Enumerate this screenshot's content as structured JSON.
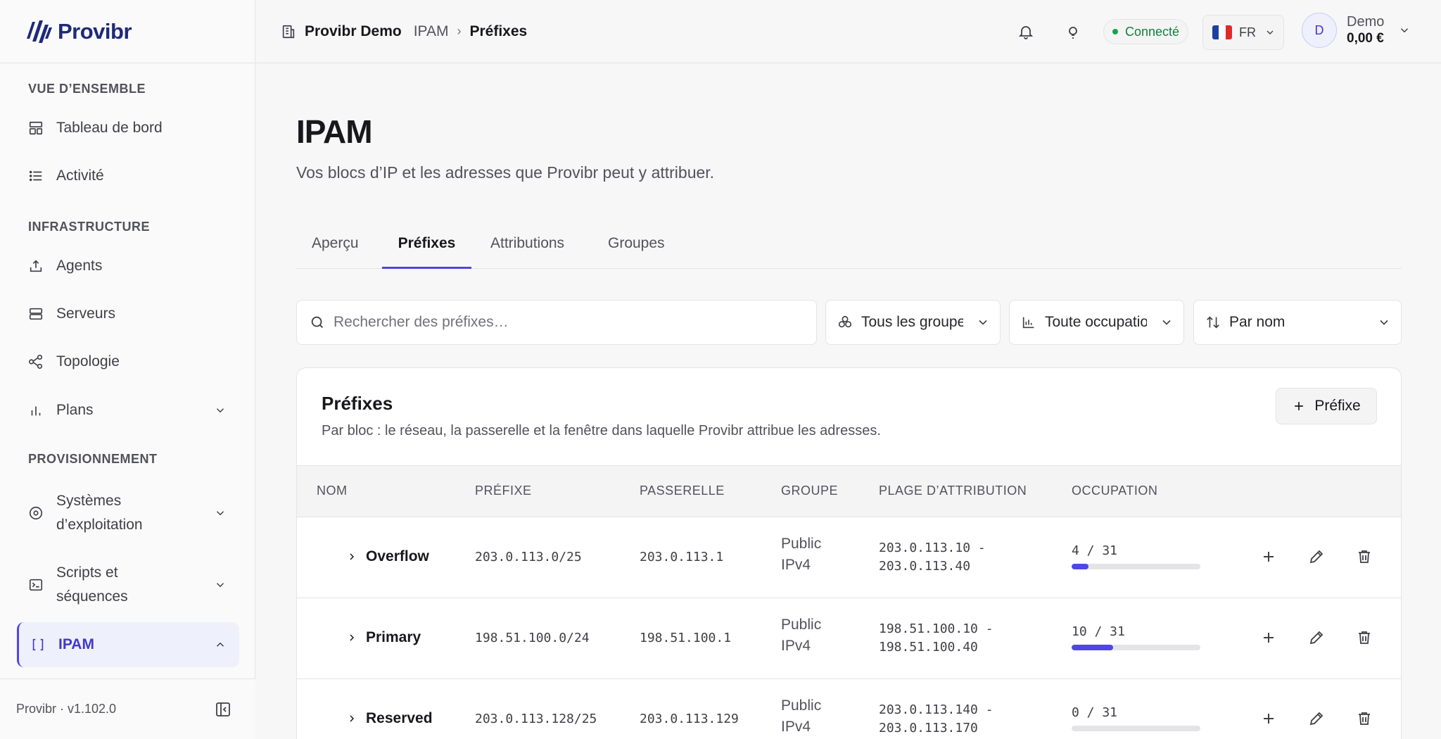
{
  "brand": {
    "name": "Provibr",
    "color": "#1e2a78",
    "accent": "#4f46e5"
  },
  "sidebar": {
    "sections": [
      {
        "title": "VUE D’ENSEMBLE"
      },
      {
        "title": "INFRASTRUCTURE"
      },
      {
        "title": "PROVISIONNEMENT"
      }
    ],
    "items": [
      {
        "label": "Tableau de bord",
        "icon": "dashboard-icon"
      },
      {
        "label": "Activité",
        "icon": "list-icon"
      },
      {
        "label": "Agents",
        "icon": "upload-tray-icon"
      },
      {
        "label": "Serveurs",
        "icon": "server-icon"
      },
      {
        "label": "Topologie",
        "icon": "share-nodes-icon"
      },
      {
        "label": "Plans",
        "icon": "bar-chart-icon"
      },
      {
        "label": "Systèmes d’exploitation",
        "line1": "Systèmes",
        "line2": "d’exploitation",
        "icon": "disc-icon"
      },
      {
        "label": "Scripts et séquences",
        "line1": "Scripts et",
        "line2": "séquences",
        "icon": "terminal-icon"
      },
      {
        "label": "IPAM",
        "icon": "brackets-icon",
        "active": true
      }
    ],
    "footer": {
      "version": "Provibr · v1.102.0"
    }
  },
  "header": {
    "org": "Provibr Demo",
    "breadcrumb": [
      "IPAM",
      "Préfixes"
    ],
    "status": "Connecté",
    "language": "FR",
    "user": {
      "initial": "D",
      "name": "Demo",
      "balance": "0,00 €"
    }
  },
  "main": {
    "title": "IPAM",
    "subtitle": "Vos blocs d’IP et les adresses que Provibr peut y attribuer.",
    "tabs": [
      {
        "label": "Aperçu"
      },
      {
        "label": "Préfixes",
        "active": true
      },
      {
        "label": "Attributions"
      },
      {
        "label": "Groupes"
      }
    ],
    "filters": {
      "search_placeholder": "Rechercher des préfixes…",
      "group": "Tous les groupes",
      "occupancy": "Toute occupation",
      "sort": "Par nom"
    },
    "card": {
      "title": "Préfixes",
      "subtitle": "Par bloc : le réseau, la passerelle et la fenêtre dans laquelle Provibr attribue les adresses.",
      "add_label": "Préfixe",
      "columns": [
        "NOM",
        "PRÉFIXE",
        "PASSERELLE",
        "GROUPE",
        "PLAGE D’ATTRIBUTION",
        "OCCUPATION"
      ],
      "rows": [
        {
          "name": "Overflow",
          "prefix": "203.0.113.0/25",
          "gateway": "203.0.113.1",
          "group_line1": "Public",
          "group_line2": "IPv4",
          "range_start": "203.0.113.10 -",
          "range_end": "203.0.113.40",
          "occupancy": "4 / 31",
          "used": 4,
          "total": 31
        },
        {
          "name": "Primary",
          "prefix": "198.51.100.0/24",
          "gateway": "198.51.100.1",
          "group_line1": "Public",
          "group_line2": "IPv4",
          "range_start": "198.51.100.10 -",
          "range_end": "198.51.100.40",
          "occupancy": "10 / 31",
          "used": 10,
          "total": 31
        },
        {
          "name": "Reserved",
          "prefix": "203.0.113.128/25",
          "gateway": "203.0.113.129",
          "group_line1": "Public",
          "group_line2": "IPv4",
          "range_start": "203.0.113.140 -",
          "range_end": "203.0.113.170",
          "occupancy": "0 / 31",
          "used": 0,
          "total": 31
        }
      ]
    }
  }
}
